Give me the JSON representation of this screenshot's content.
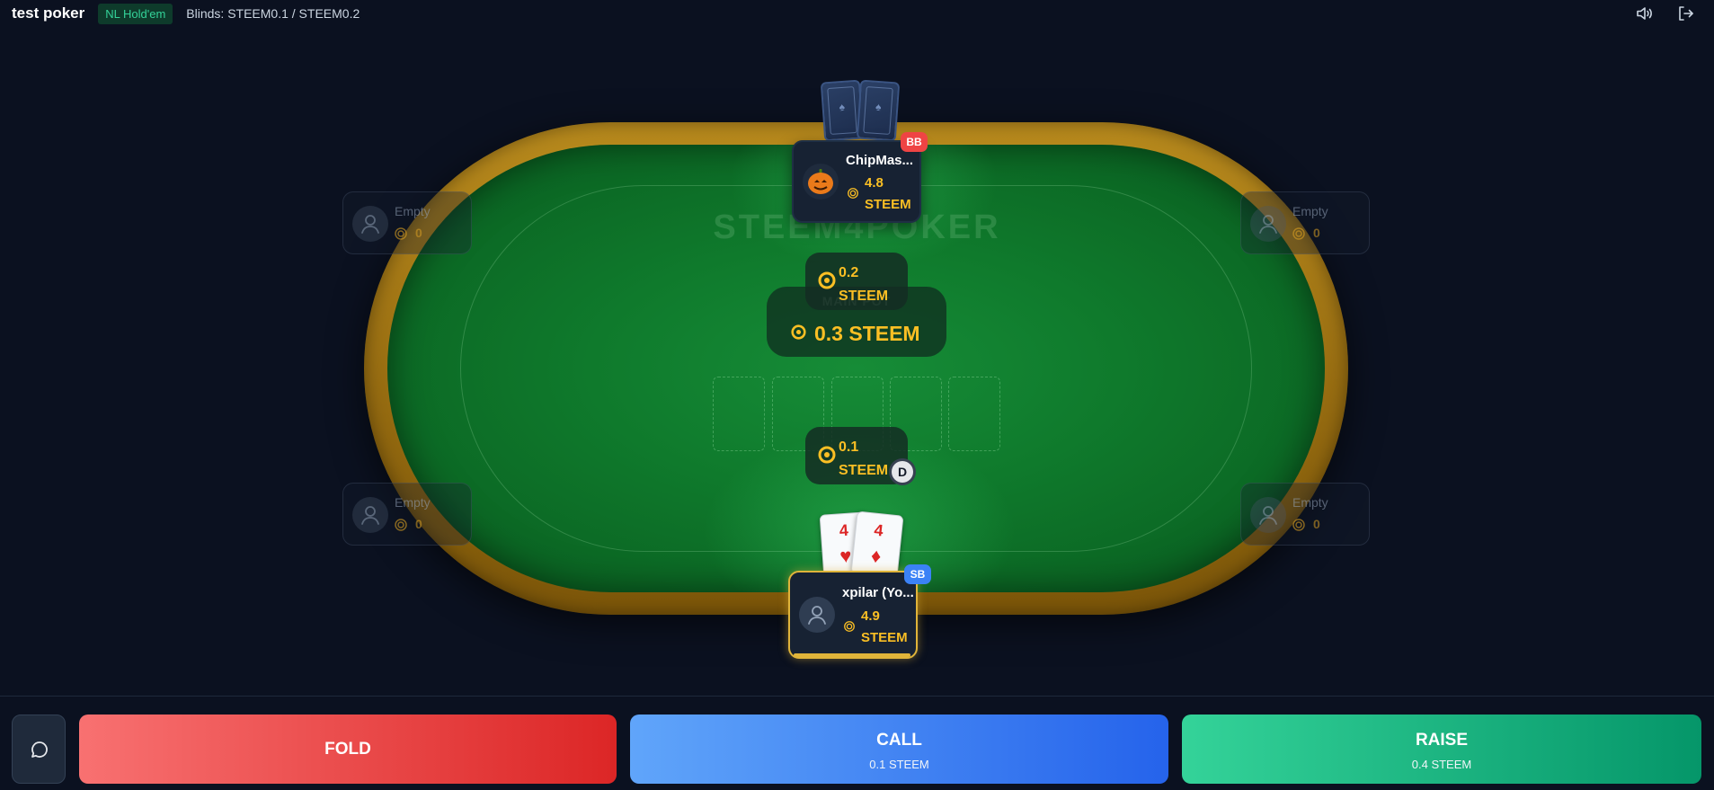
{
  "header": {
    "room_name": "test poker",
    "game_type": "NL Hold'em",
    "blinds": "Blinds: STEEM0.1 / STEEM0.2",
    "icons": [
      "speaker-icon",
      "logout-icon"
    ]
  },
  "table": {
    "watermark": "STEEM4POKER",
    "pot": {
      "label": "MAIN POT",
      "amount": "0.3 STEEM"
    },
    "community_cards": [],
    "bets": {
      "top": "0.2 STEEM",
      "bottom": "0.1 STEEM"
    },
    "dealer_button": "D"
  },
  "seats": {
    "top_left": {
      "name": "Empty",
      "stack": "0"
    },
    "top_right": {
      "name": "Empty",
      "stack": "0"
    },
    "bottom_left": {
      "name": "Empty",
      "stack": "0"
    },
    "bottom_right": {
      "name": "Empty",
      "stack": "0"
    }
  },
  "players": {
    "opponent": {
      "name": "ChipMas...",
      "stack": "4.8 STEEM",
      "position": "BB",
      "position_color": "#ef4444"
    },
    "hero": {
      "name": "xpilar (Yo...",
      "stack": "4.9 STEEM",
      "position": "SB",
      "position_color": "#3b82f6",
      "cards": [
        {
          "rank": "4",
          "suit": "♥"
        },
        {
          "rank": "4",
          "suit": "♦"
        }
      ]
    }
  },
  "actions": {
    "fold": {
      "label": "FOLD"
    },
    "call": {
      "label": "CALL",
      "amount": "0.1 STEEM"
    },
    "raise": {
      "label": "RAISE",
      "amount": "0.4 STEEM"
    }
  },
  "colors": {
    "felt": "#0f7a2c",
    "rail": "#9a6f12",
    "gold_text": "#fbbf24",
    "fold": "#dc2626",
    "call": "#2563eb",
    "raise": "#059669"
  }
}
